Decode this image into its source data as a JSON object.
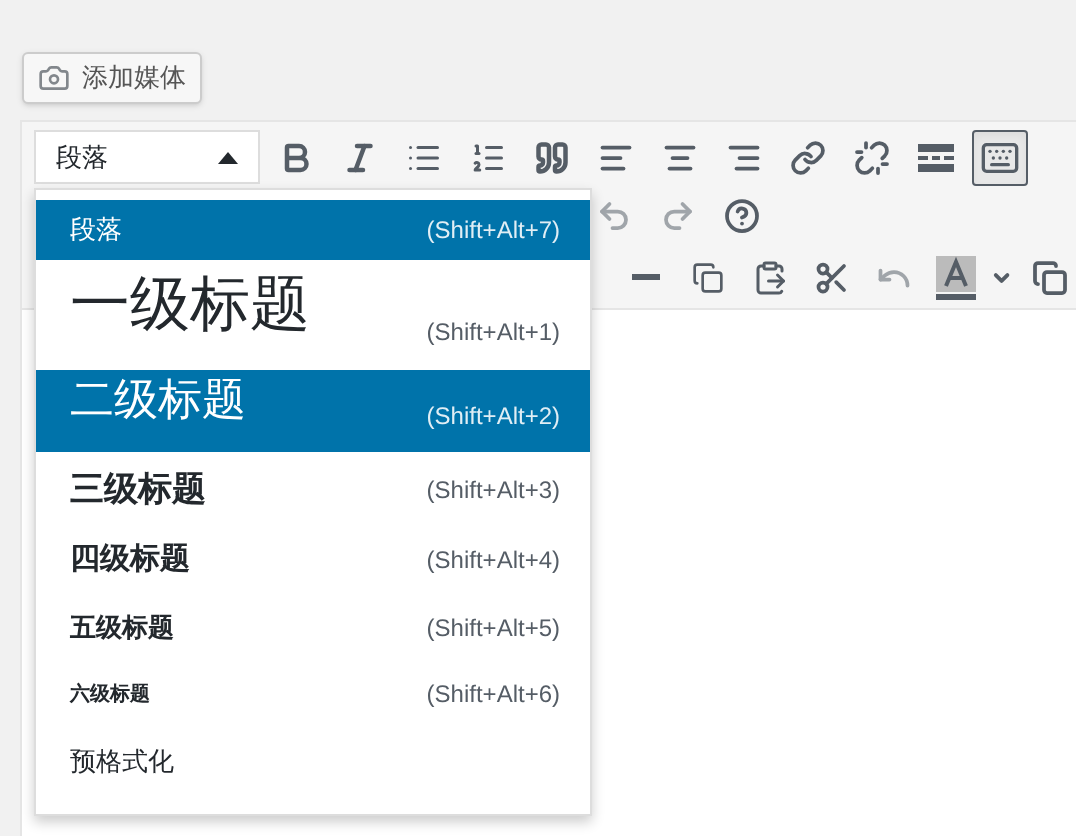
{
  "add_media_button": {
    "label": "添加媒体"
  },
  "format_select": {
    "value": "段落",
    "expanded": true
  },
  "toolbar": {
    "toolbar_toggle": {
      "pressed": true
    },
    "undo": {
      "disabled": true
    },
    "redo": {
      "disabled": true
    },
    "revert": {
      "disabled": true
    }
  },
  "format_menu": [
    {
      "kind": "paragraph",
      "label": "段落",
      "shortcut": "(Shift+Alt+7)",
      "selected": true
    },
    {
      "kind": "h1",
      "label": "一级标题",
      "shortcut": "(Shift+Alt+1)",
      "selected": false
    },
    {
      "kind": "h2",
      "label": "二级标题",
      "shortcut": "(Shift+Alt+2)",
      "selected": true
    },
    {
      "kind": "h3",
      "label": "三级标题",
      "shortcut": "(Shift+Alt+3)",
      "selected": false
    },
    {
      "kind": "h4",
      "label": "四级标题",
      "shortcut": "(Shift+Alt+4)",
      "selected": false
    },
    {
      "kind": "h5",
      "label": "五级标题",
      "shortcut": "(Shift+Alt+5)",
      "selected": false
    },
    {
      "kind": "h6",
      "label": "六级标题",
      "shortcut": "(Shift+Alt+6)",
      "selected": false
    },
    {
      "kind": "pre",
      "label": "预格式化",
      "selected": false
    }
  ]
}
